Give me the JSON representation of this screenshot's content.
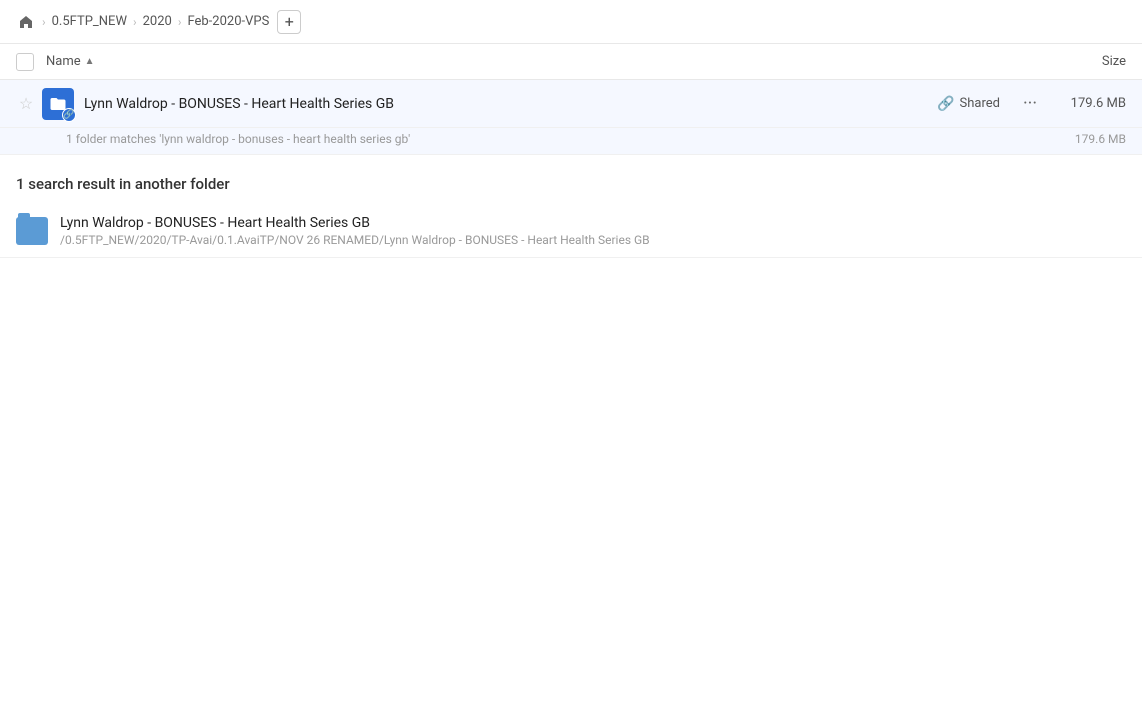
{
  "breadcrumb": {
    "home_label": "home",
    "items": [
      {
        "label": "0.5FTP_NEW"
      },
      {
        "label": "2020"
      },
      {
        "label": "Feb-2020-VPS"
      }
    ],
    "add_label": "+"
  },
  "column_header": {
    "name_label": "Name",
    "sort_arrow": "▲",
    "size_label": "Size"
  },
  "main_item": {
    "name": "Lynn Waldrop - BONUSES - Heart Health Series GB",
    "shared_label": "Shared",
    "size": "179.6 MB",
    "match_hint": "1 folder matches 'lynn waldrop - bonuses - heart health series gb'",
    "match_hint_size": "179.6 MB"
  },
  "section": {
    "heading": "1 search result in another folder"
  },
  "search_result": {
    "name": "Lynn Waldrop - BONUSES - Heart Health Series GB",
    "path": "/0.5FTP_NEW/2020/TP-Avai/0.1.AvaiTP/NOV 26 RENAMED/Lynn Waldrop - BONUSES - Heart Health Series GB"
  }
}
